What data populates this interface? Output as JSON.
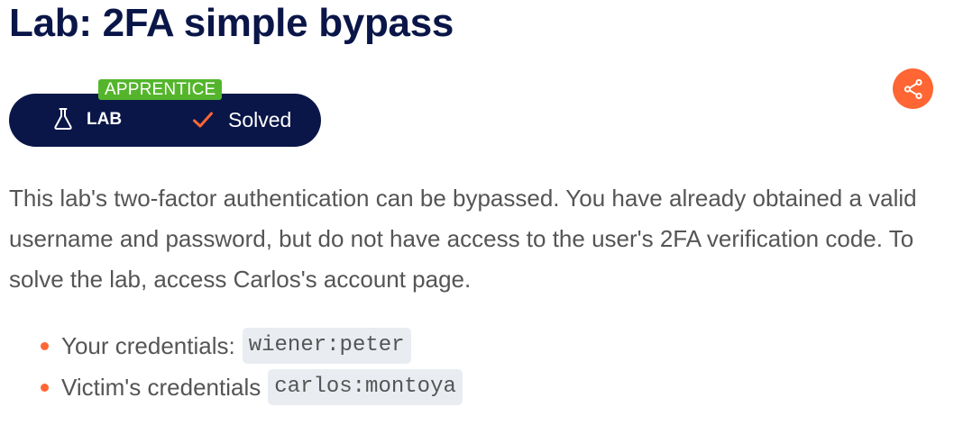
{
  "page": {
    "title": "Lab: 2FA simple bypass"
  },
  "badge": {
    "level": "APPRENTICE",
    "type_label": "LAB",
    "status_label": "Solved",
    "flask_icon": "flask-icon",
    "check_icon": "check-icon"
  },
  "share": {
    "icon": "share-icon"
  },
  "description": "This lab's two-factor authentication can be bypassed. You have already obtained a valid username and password, but do not have access to the user's 2FA verification code. To solve the lab, access Carlos's account page.",
  "credentials": [
    {
      "label": "Your credentials:",
      "value": "wiener:peter"
    },
    {
      "label": "Victim's credentials",
      "value": "carlos:montoya"
    }
  ],
  "colors": {
    "brand_navy": "#0a1648",
    "accent_orange": "#ff6633",
    "level_green": "#54b52c",
    "text_gray": "#555555",
    "code_bg": "#e9edf2"
  }
}
